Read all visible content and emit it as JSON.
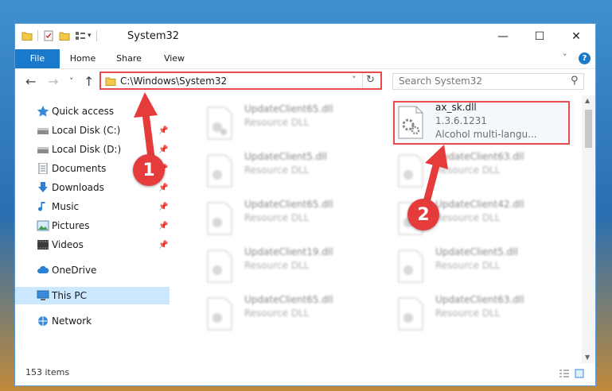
{
  "window": {
    "title": "System32",
    "controls": {
      "minimize": "—",
      "maximize": "☐",
      "close": "✕"
    }
  },
  "ribbon": {
    "tabs": [
      {
        "label": "File"
      },
      {
        "label": "Home"
      },
      {
        "label": "Share"
      },
      {
        "label": "View"
      }
    ],
    "expand": "˅",
    "help": "?"
  },
  "nav": {
    "back": "←",
    "forward": "→",
    "recent": "˅",
    "up": "↑",
    "address": "C:\\Windows\\System32",
    "address_dropdown": "˅",
    "refresh": "↻",
    "search_placeholder": "Search System32",
    "search_icon": "⚲"
  },
  "sidebar": {
    "items": [
      {
        "label": "Quick access",
        "icon": "star-icon",
        "pinned": false
      },
      {
        "label": "Local Disk (C:)",
        "icon": "drive-icon",
        "pinned": true
      },
      {
        "label": "Local Disk (D:)",
        "icon": "drive-icon",
        "pinned": true
      },
      {
        "label": "Documents",
        "icon": "documents-icon",
        "pinned": true
      },
      {
        "label": "Downloads",
        "icon": "download-icon",
        "pinned": true
      },
      {
        "label": "Music",
        "icon": "music-icon",
        "pinned": true
      },
      {
        "label": "Pictures",
        "icon": "pictures-icon",
        "pinned": true
      },
      {
        "label": "Videos",
        "icon": "videos-icon",
        "pinned": true
      },
      {
        "label": "OneDrive",
        "icon": "cloud-icon",
        "pinned": false
      },
      {
        "label": "This PC",
        "icon": "pc-icon",
        "pinned": false
      },
      {
        "label": "Network",
        "icon": "network-icon",
        "pinned": false
      }
    ]
  },
  "files": [
    {
      "name": "UpdateClient65.dll",
      "type": "Resource DLL"
    },
    {
      "name": "ax_sk.dll",
      "type": "1.3.6.1231",
      "desc": "Alcohol multi-langu..."
    },
    {
      "name": "UpdateClient5.dll",
      "type": "Resource DLL"
    },
    {
      "name": "UpdateClient63.dll",
      "type": "Resource DLL"
    },
    {
      "name": "UpdateClient65.dll",
      "type": "Resource DLL"
    },
    {
      "name": "UpdateClient42.dll",
      "type": "Resource DLL"
    },
    {
      "name": "UpdateClient19.dll",
      "type": "Resource DLL"
    },
    {
      "name": "UpdateClient5.dll",
      "type": "Resource DLL"
    },
    {
      "name": "UpdateClient65.dll",
      "type": "Resource DLL"
    },
    {
      "name": "UpdateClient63.dll",
      "type": "Resource DLL"
    }
  ],
  "status": {
    "items": "153 items"
  },
  "annotations": {
    "step1": "1",
    "step2": "2"
  },
  "colors": {
    "accent": "#1979ca",
    "highlight": "#e74c4c",
    "selected": "#cce8ff"
  }
}
